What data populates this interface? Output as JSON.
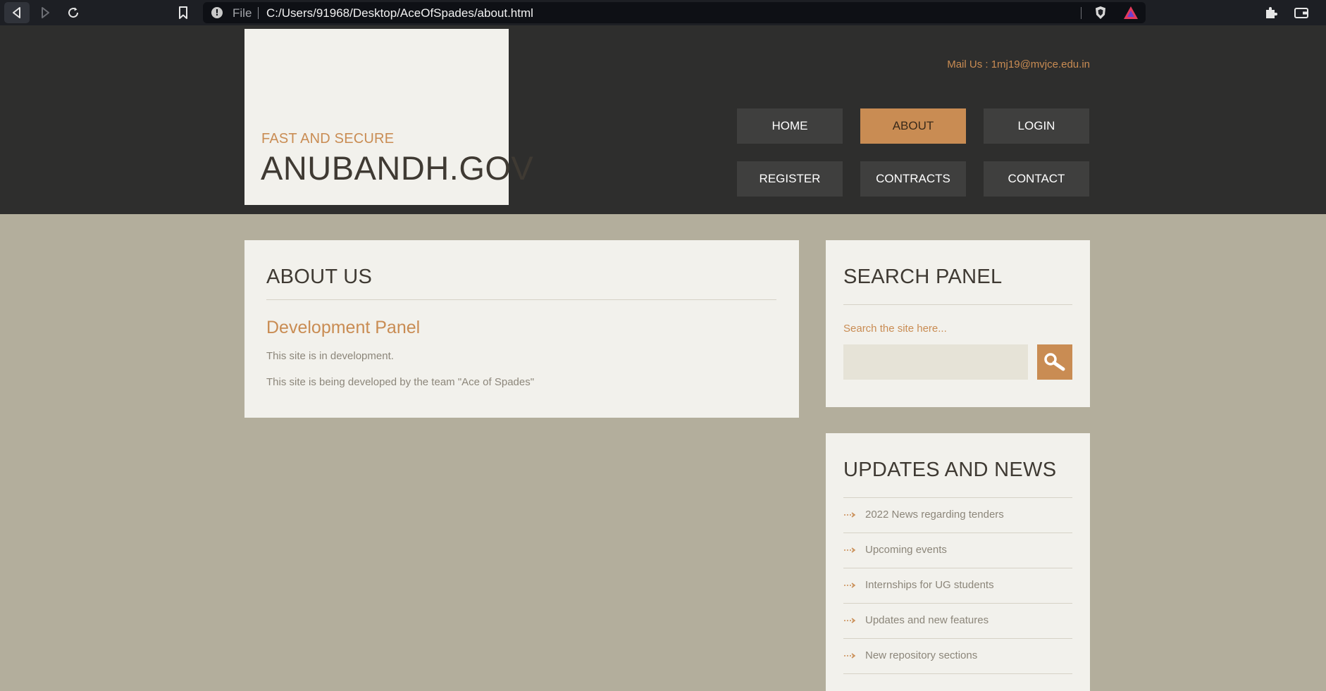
{
  "browser": {
    "file_label": "File",
    "url": "C:/Users/91968/Desktop/AceOfSpades/about.html"
  },
  "header": {
    "tagline": "FAST AND SECURE",
    "title": "ANUBANDH.GOV",
    "mail": "Mail Us : 1mj19@mvjce.edu.in",
    "nav": [
      {
        "label": "HOME",
        "active": false
      },
      {
        "label": "ABOUT",
        "active": true
      },
      {
        "label": "LOGIN",
        "active": false
      },
      {
        "label": "REGISTER",
        "active": false
      },
      {
        "label": "CONTRACTS",
        "active": false
      },
      {
        "label": "CONTACT",
        "active": false
      }
    ]
  },
  "about": {
    "heading": "ABOUT US",
    "subheading": "Development Panel",
    "paragraphs": [
      "This site is in development.",
      "This site is being developed by the team \"Ace of Spades\""
    ]
  },
  "search": {
    "heading": "SEARCH PANEL",
    "label": "Search the site here...",
    "value": "",
    "icon": "search-icon"
  },
  "news": {
    "heading": "UPDATES AND NEWS",
    "items": [
      "2022 News regarding tenders",
      "Upcoming events",
      "Internships for UG students",
      "Updates and new features",
      "New repository sections"
    ]
  },
  "colors": {
    "accent": "#c98c53",
    "header_bg": "#2e2e2d",
    "page_bg": "#b3ae9c",
    "panel_bg": "#f2f1ec",
    "nav_bg": "#3f3f3e"
  }
}
